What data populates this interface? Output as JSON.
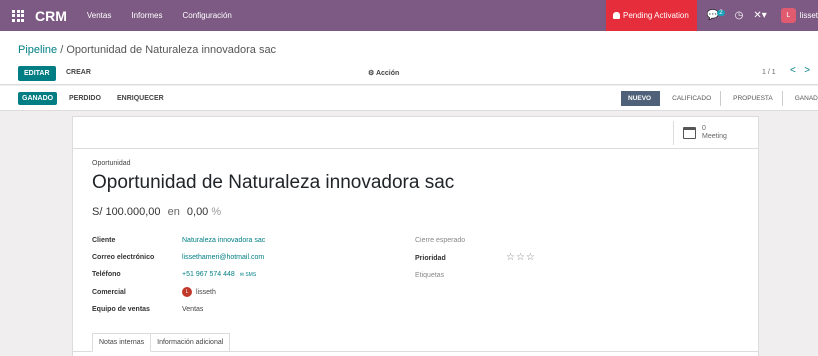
{
  "navbar": {
    "brand": "CRM",
    "menu": [
      "Ventas",
      "Informes",
      "Configuración"
    ],
    "pending_label": "Pending Activation",
    "chat_count": "2",
    "user_initial": "L",
    "user_name": "lisset"
  },
  "breadcrumb": {
    "parent": "Pipeline",
    "separator": " / ",
    "current": "Oportunidad de Naturaleza innovadora sac"
  },
  "toolbar": {
    "edit_label": "EDITAR",
    "create_label": "CREAR",
    "action_label": "⚙ Acción",
    "pager": "1 / 1",
    "prev": "<",
    "next": ">"
  },
  "statusbar": {
    "won_label": "GANADO",
    "lost_label": "PERDIDO",
    "enrich_label": "ENRIQUECER",
    "stages": [
      "NUEVO",
      "CALIFICADO",
      "PROPUESTA",
      "GANADO"
    ],
    "active_stage": "NUEVO"
  },
  "sheet": {
    "meeting_count": "0",
    "meeting_label": "Meeting",
    "type_label": "Oportunidad",
    "title": "Oportunidad de Naturaleza innovadora sac",
    "revenue": "S/ 100.000,00",
    "revenue_en": "en",
    "probability": "0,00",
    "percent": "%",
    "fields": {
      "cliente_label": "Cliente",
      "cliente_value": "Naturaleza innovadora sac",
      "email_label": "Correo electrónico",
      "email_value": "lissethameri@hotmail.com",
      "phone_label": "Teléfono",
      "phone_value": "+51 967 574 448",
      "sms_label": "SMS",
      "salesperson_label": "Comercial",
      "salesperson_initial": "L",
      "salesperson_value": "lisseth",
      "team_label": "Equipo de ventas",
      "team_value": "Ventas",
      "close_label": "Cierre esperado",
      "priority_label": "Prioridad",
      "priority_stars": "☆☆☆",
      "tags_label": "Etiquetas"
    },
    "tabs": [
      "Notas internas",
      "Información adicional"
    ]
  }
}
